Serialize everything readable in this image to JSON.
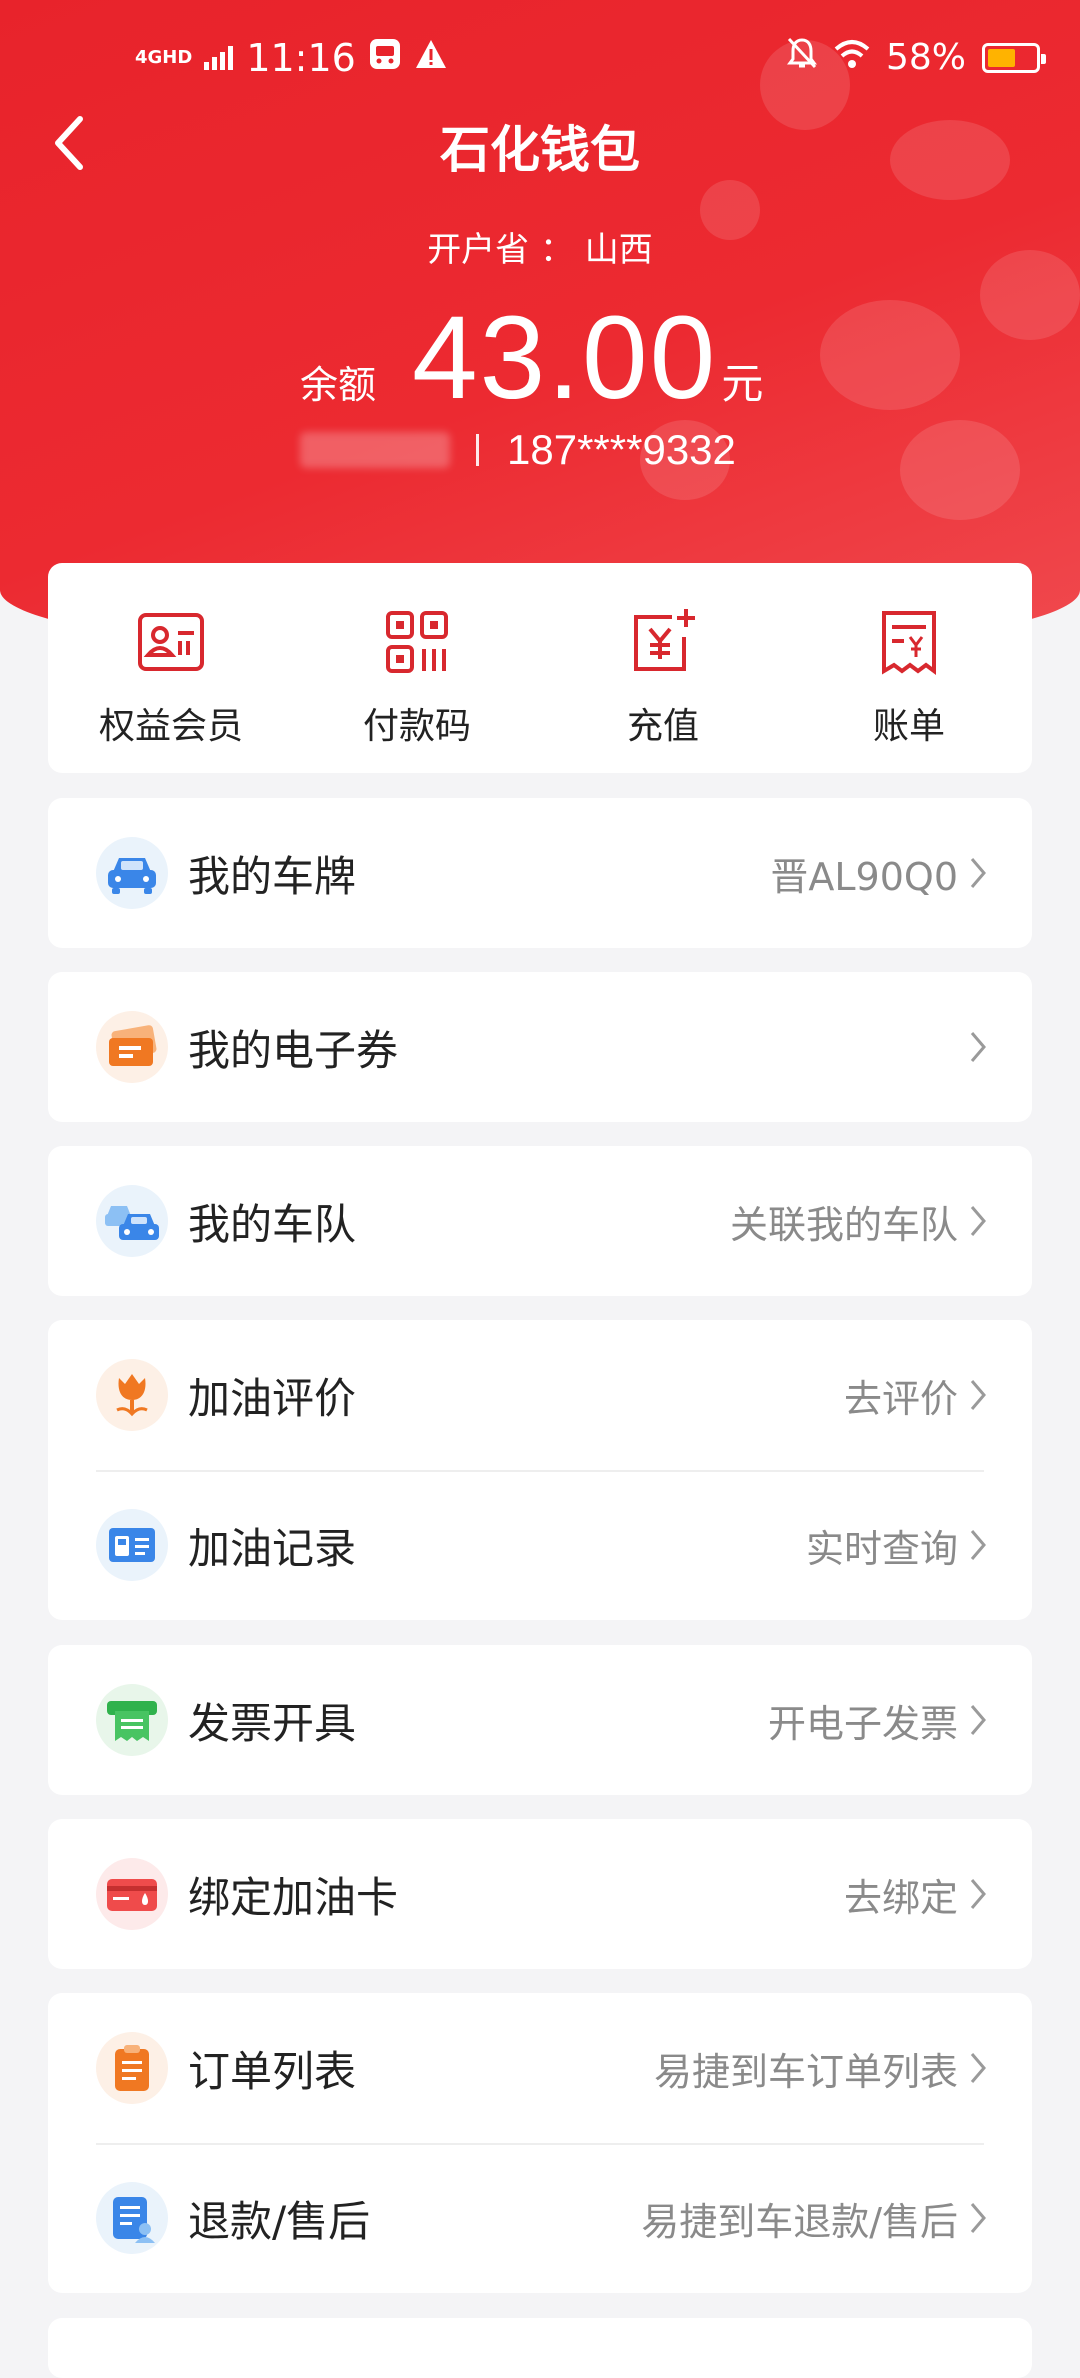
{
  "status_bar": {
    "network": "4GHD",
    "time": "11:16",
    "battery_percent": "58%",
    "battery_level": 0.58
  },
  "header": {
    "title": "石化钱包",
    "province": "开户省 ： 山西",
    "balance_label": "余额",
    "balance_value": "43.00",
    "balance_unit": "元",
    "phone": "187****9332"
  },
  "quick_actions": [
    {
      "label": "权益会员",
      "icon": "member-card-icon"
    },
    {
      "label": "付款码",
      "icon": "qr-code-icon"
    },
    {
      "label": "充值",
      "icon": "recharge-icon"
    },
    {
      "label": "账单",
      "icon": "bill-icon"
    }
  ],
  "menu": {
    "plate": {
      "label": "我的车牌",
      "value": "晋AL90Q0"
    },
    "coupon": {
      "label": "我的电子券",
      "value": ""
    },
    "fleet": {
      "label": "我的车队",
      "value": "关联我的车队"
    },
    "review": {
      "label": "加油评价",
      "value": "去评价"
    },
    "records": {
      "label": "加油记录",
      "value": "实时查询"
    },
    "invoice": {
      "label": "发票开具",
      "value": "开电子发票"
    },
    "card": {
      "label": "绑定加油卡",
      "value": "去绑定"
    },
    "orders": {
      "label": "订单列表",
      "value": "易捷到车订单列表"
    },
    "refund": {
      "label": "退款/售后",
      "value": "易捷到车退款/售后"
    }
  },
  "colors": {
    "brand_red": "#e8232b",
    "icon_red": "#d8282e",
    "chevron": "#9a9a9a"
  }
}
